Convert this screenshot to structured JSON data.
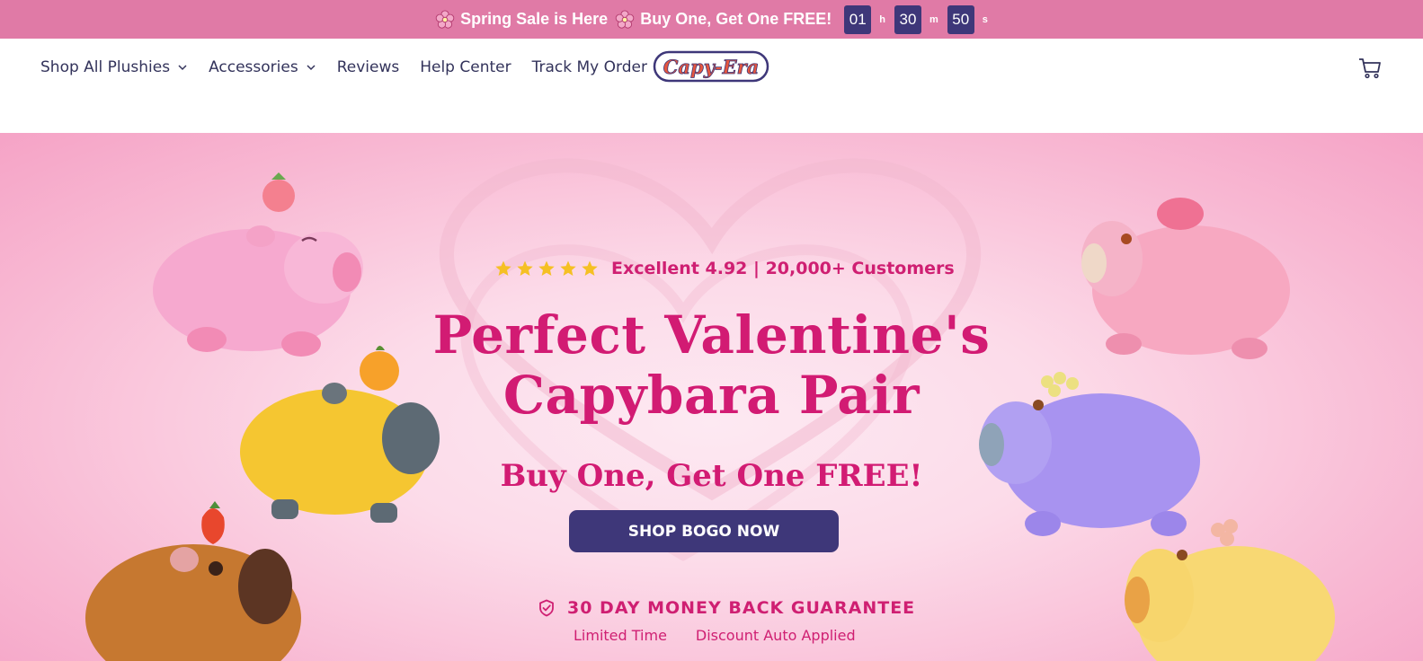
{
  "announcement": {
    "message_1": "Spring Sale is Here",
    "message_2": "Buy One, Get One FREE!",
    "icon": "flower-icon",
    "countdown": {
      "hours": "01",
      "hours_unit": "h",
      "minutes": "30",
      "minutes_unit": "m",
      "seconds": "50",
      "seconds_unit": "s"
    }
  },
  "nav": {
    "items": [
      {
        "label": "Shop All Plushies",
        "has_dropdown": true
      },
      {
        "label": "Accessories",
        "has_dropdown": true
      },
      {
        "label": "Reviews",
        "has_dropdown": false
      },
      {
        "label": "Help Center",
        "has_dropdown": false
      },
      {
        "label": "Track My Order",
        "has_dropdown": false
      }
    ],
    "logo_text": "Capy-Era",
    "cart_icon": "cart-icon"
  },
  "hero": {
    "rating_stars": 5,
    "rating_text": "Excellent 4.92 | 20,000+ Customers",
    "headline_line1": "Perfect Valentine's",
    "headline_line2": "Capybara Pair",
    "subheadline": "Buy One, Get One FREE!",
    "cta_label": "SHOP BOGO NOW",
    "guarantee": "30 DAY MONEY BACK GUARANTEE",
    "perks": [
      "Limited Time",
      "Discount Auto Applied"
    ]
  },
  "colors": {
    "announcement_bg": "#e07aa6",
    "brand_navy": "#3e3779",
    "brand_pink": "#d21b73",
    "star": "#f5c024"
  }
}
